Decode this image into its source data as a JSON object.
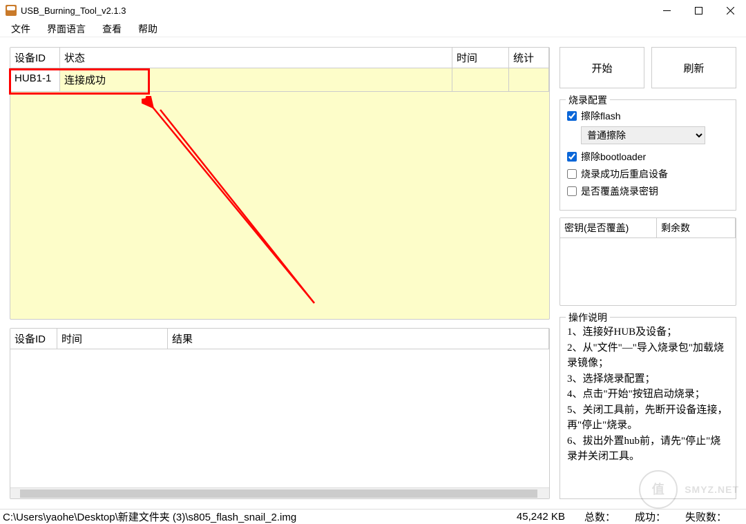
{
  "window": {
    "title": "USB_Burning_Tool_v2.1.3"
  },
  "menu": {
    "file": "文件",
    "lang": "界面语言",
    "view": "查看",
    "help": "帮助"
  },
  "upper_table": {
    "headers": {
      "id": "设备ID",
      "status": "状态",
      "time": "时间",
      "stat": "统计"
    },
    "rows": [
      {
        "id": "HUB1-1",
        "status": "连接成功",
        "time": "",
        "stat": ""
      }
    ]
  },
  "lower_table": {
    "headers": {
      "id": "设备ID",
      "time": "时间",
      "result": "结果"
    }
  },
  "buttons": {
    "start": "开始",
    "refresh": "刷新"
  },
  "config": {
    "title": "烧录配置",
    "erase_flash": "擦除flash",
    "erase_mode_selected": "普通擦除",
    "erase_bootloader": "擦除bootloader",
    "reboot_after": "烧录成功后重启设备",
    "overwrite_key": "是否覆盖烧录密钥"
  },
  "key_table": {
    "headers": {
      "key": "密钥(是否覆盖)",
      "remain": "剩余数"
    }
  },
  "instructions": {
    "title": "操作说明",
    "l1": "1、连接好HUB及设备；",
    "l2": "2、从\"文件\"—\"导入烧录包\"加载烧录镜像；",
    "l3": "3、选择烧录配置；",
    "l4": "4、点击\"开始\"按钮启动烧录；",
    "l5": "5、关闭工具前，先断开设备连接，再\"停止\"烧录。",
    "l6": "6、拔出外置hub前，请先\"停止\"烧录并关闭工具。"
  },
  "statusbar": {
    "path": "C:\\Users\\yaohe\\Desktop\\新建文件夹 (3)\\s805_flash_snail_2.img",
    "size": "45,242 KB",
    "total_label": "总数：",
    "success_label": "成功：",
    "fail_label": "失败数："
  },
  "watermark": {
    "text": "SMYZ.NET"
  }
}
